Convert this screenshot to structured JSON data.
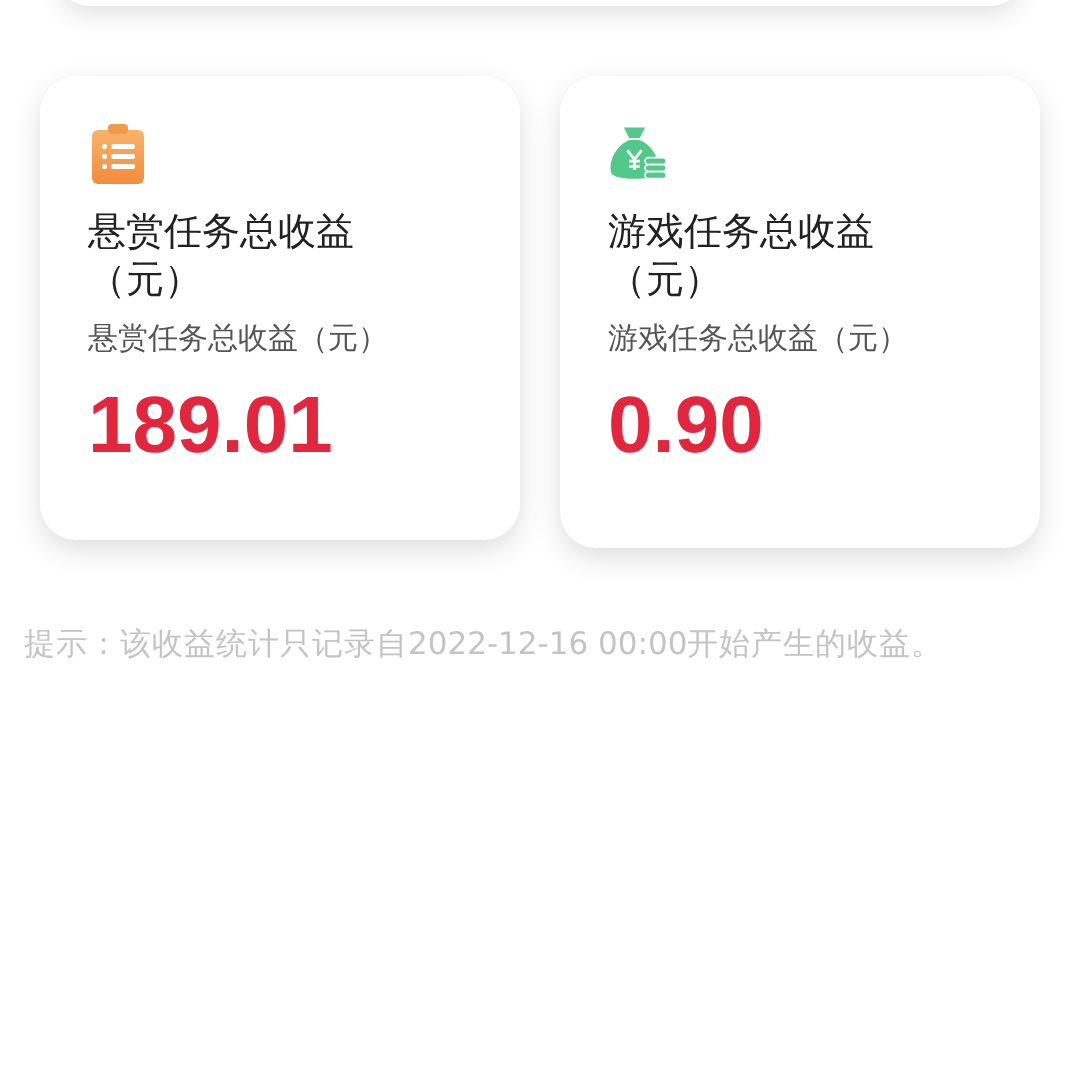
{
  "cards": [
    {
      "kind": "clipboard",
      "title": "悬赏任务总收益（元）",
      "subtitle": "悬赏任务总收益（元）",
      "value": "189.01"
    },
    {
      "kind": "money-bag",
      "title": "游戏任务总收益（元）",
      "subtitle": "游戏任务总收益（元）",
      "value": "0.90"
    }
  ],
  "tip": "提示：该收益统计只记录自2022-12-16 00:00开始产生的收益。"
}
